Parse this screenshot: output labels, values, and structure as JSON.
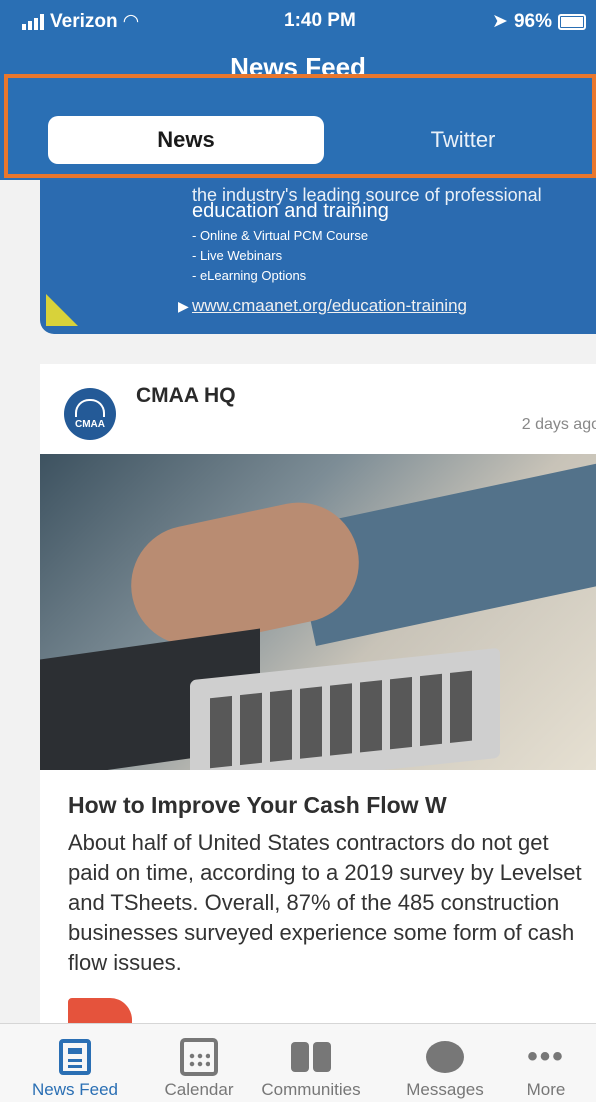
{
  "status_bar": {
    "carrier": "Verizon",
    "time": "1:40 PM",
    "battery": "96%"
  },
  "nav": {
    "title": "News Feed"
  },
  "segments": {
    "active": "News",
    "inactive": "Twitter"
  },
  "promo": {
    "headline": "the industry's leading source of professional",
    "edu": "education and training",
    "items": [
      "- Online & Virtual PCM Course",
      "- Live Webinars",
      "- eLearning Options"
    ],
    "link": "www.cmaanet.org/education-training"
  },
  "post": {
    "avatar_text": "CMAA",
    "author": "CMAA HQ",
    "time_ago": "2 days ago",
    "headline": "How to Improve Your Cash Flow W",
    "body": "About half of United States contractors do not get paid on time, according to a 2019 survey by Levelset and TSheets. Overall, 87% of the 485 construction businesses surveyed experience some form of cash flow issues."
  },
  "tabs": [
    {
      "label": "News Feed",
      "icon": "news-feed-icon",
      "active": true
    },
    {
      "label": "Calendar",
      "icon": "calendar-icon",
      "active": false
    },
    {
      "label": "Communities",
      "icon": "communities-icon",
      "active": false
    },
    {
      "label": "Messages",
      "icon": "messages-icon",
      "active": false
    },
    {
      "label": "More",
      "icon": "more-icon",
      "active": false
    }
  ],
  "colors": {
    "brand_blue": "#2a6fb4",
    "highlight_orange": "#e8772e"
  }
}
